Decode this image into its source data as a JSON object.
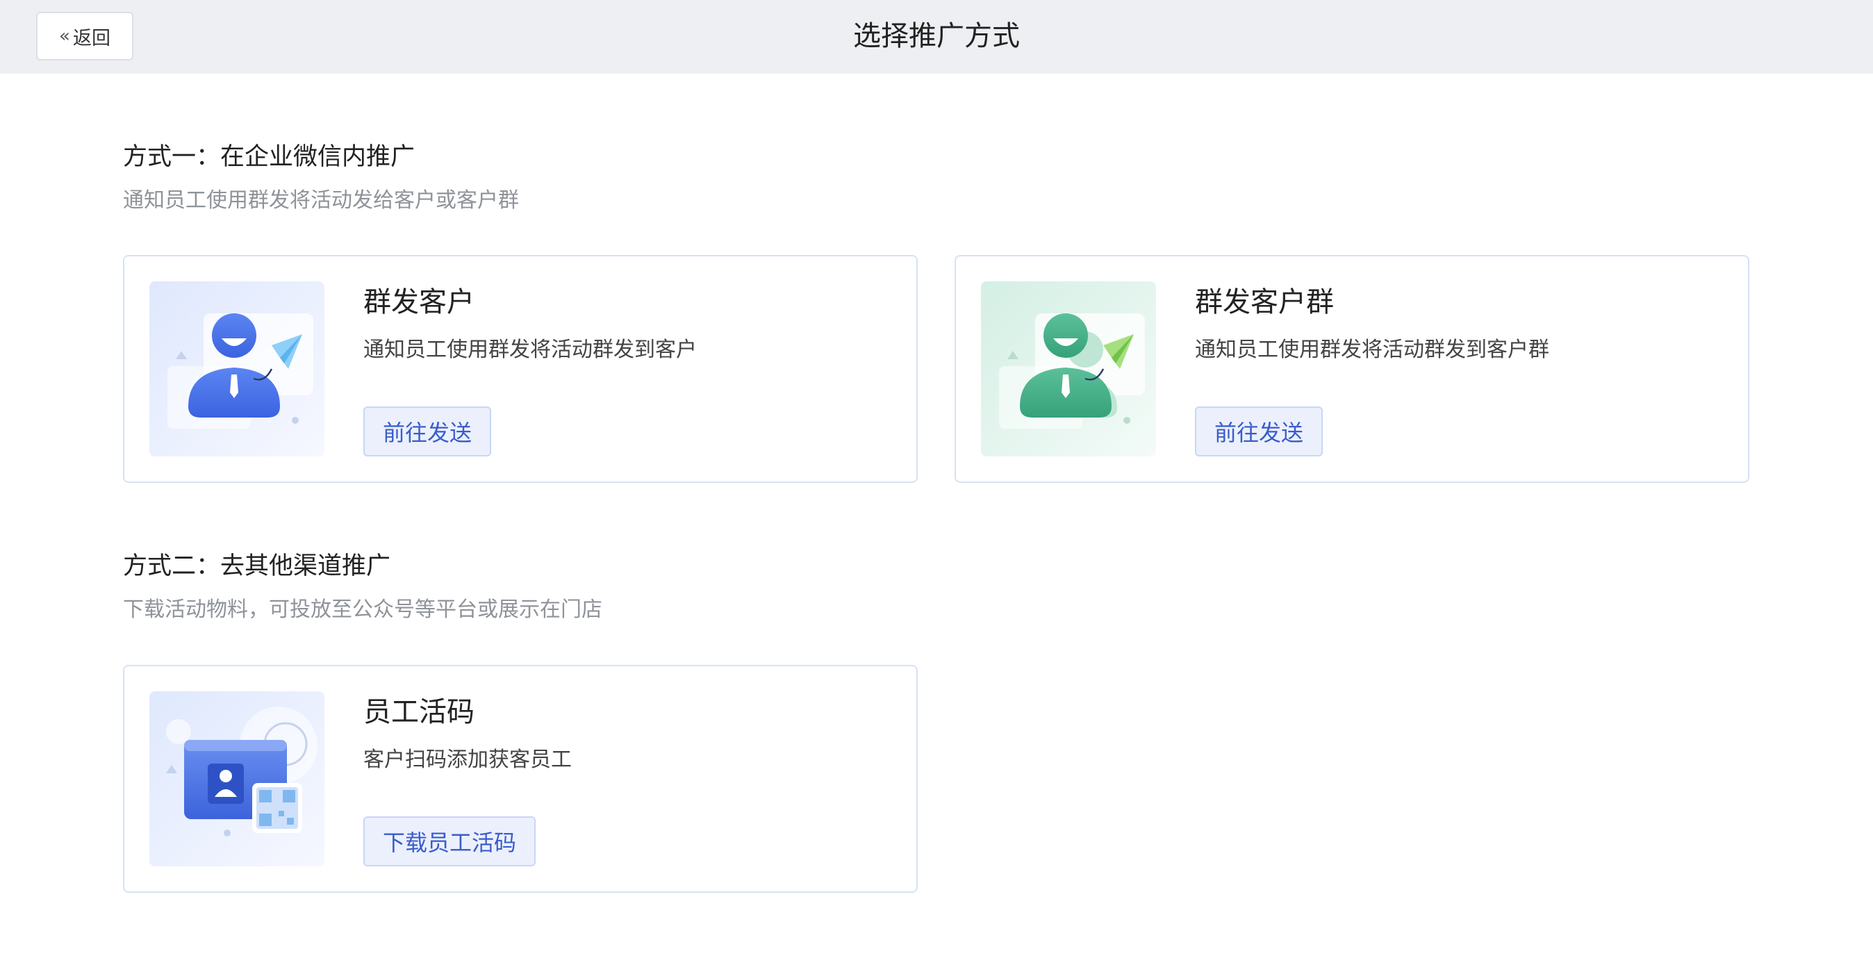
{
  "header": {
    "back_label": "返回",
    "title": "选择推广方式"
  },
  "sections": [
    {
      "title": "方式一：在企业微信内推广",
      "description": "通知员工使用群发将活动发给客户或客户群",
      "cards": [
        {
          "title": "群发客户",
          "description": "通知员工使用群发将活动群发到客户",
          "action": "前往发送",
          "icon": "blue-person-paper-plane-illustration"
        },
        {
          "title": "群发客户群",
          "description": "通知员工使用群发将活动群发到客户群",
          "action": "前往发送",
          "icon": "green-group-paper-plane-illustration"
        }
      ]
    },
    {
      "title": "方式二：去其他渠道推广",
      "description": "下载活动物料，可投放至公众号等平台或展示在门店",
      "cards": [
        {
          "title": "员工活码",
          "description": "客户扫码添加获客员工",
          "action": "下载员工活码",
          "icon": "employee-qr-card-illustration"
        }
      ]
    }
  ],
  "colors": {
    "topbar_bg": "#eeeff2",
    "accent": "#3a5ccc",
    "card_border": "#d6e2f5",
    "button_bg": "#ebf0fc"
  }
}
